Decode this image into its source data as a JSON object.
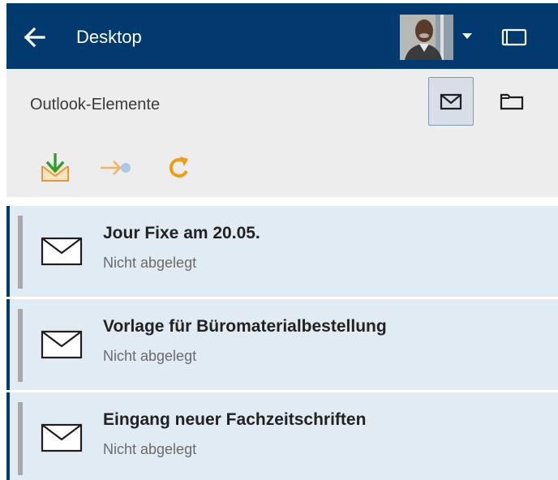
{
  "header": {
    "title": "Desktop",
    "back_icon": "arrow-left-icon",
    "avatar_icon": "user-avatar",
    "menu_icon": "caret-down-icon",
    "panel_icon": "panel-toggle-icon",
    "background_color": "#003a6e"
  },
  "toolbar": {
    "section_title": "Outlook-Elemente",
    "view_buttons": [
      {
        "icon": "envelope-icon",
        "selected": true
      },
      {
        "icon": "folder-icon",
        "selected": false
      }
    ],
    "actions": [
      {
        "icon": "import-tray-icon",
        "color": "#2e9e2e"
      },
      {
        "icon": "move-arrow-icon",
        "color": "#f2b35e",
        "disabled": true
      },
      {
        "icon": "refresh-icon",
        "color": "#f39c12"
      }
    ]
  },
  "items": [
    {
      "subject": "Jour Fixe am 20.05.",
      "status": "Nicht abgelegt"
    },
    {
      "subject": "Vorlage für Büromaterialbestellung",
      "status": "Nicht abgelegt"
    },
    {
      "subject": "Eingang neuer Fachzeitschriften",
      "status": "Nicht abgelegt"
    }
  ],
  "colors": {
    "accent": "#003a6e",
    "list_background": "#e1ebf3",
    "toolbar_background": "#ededed"
  }
}
